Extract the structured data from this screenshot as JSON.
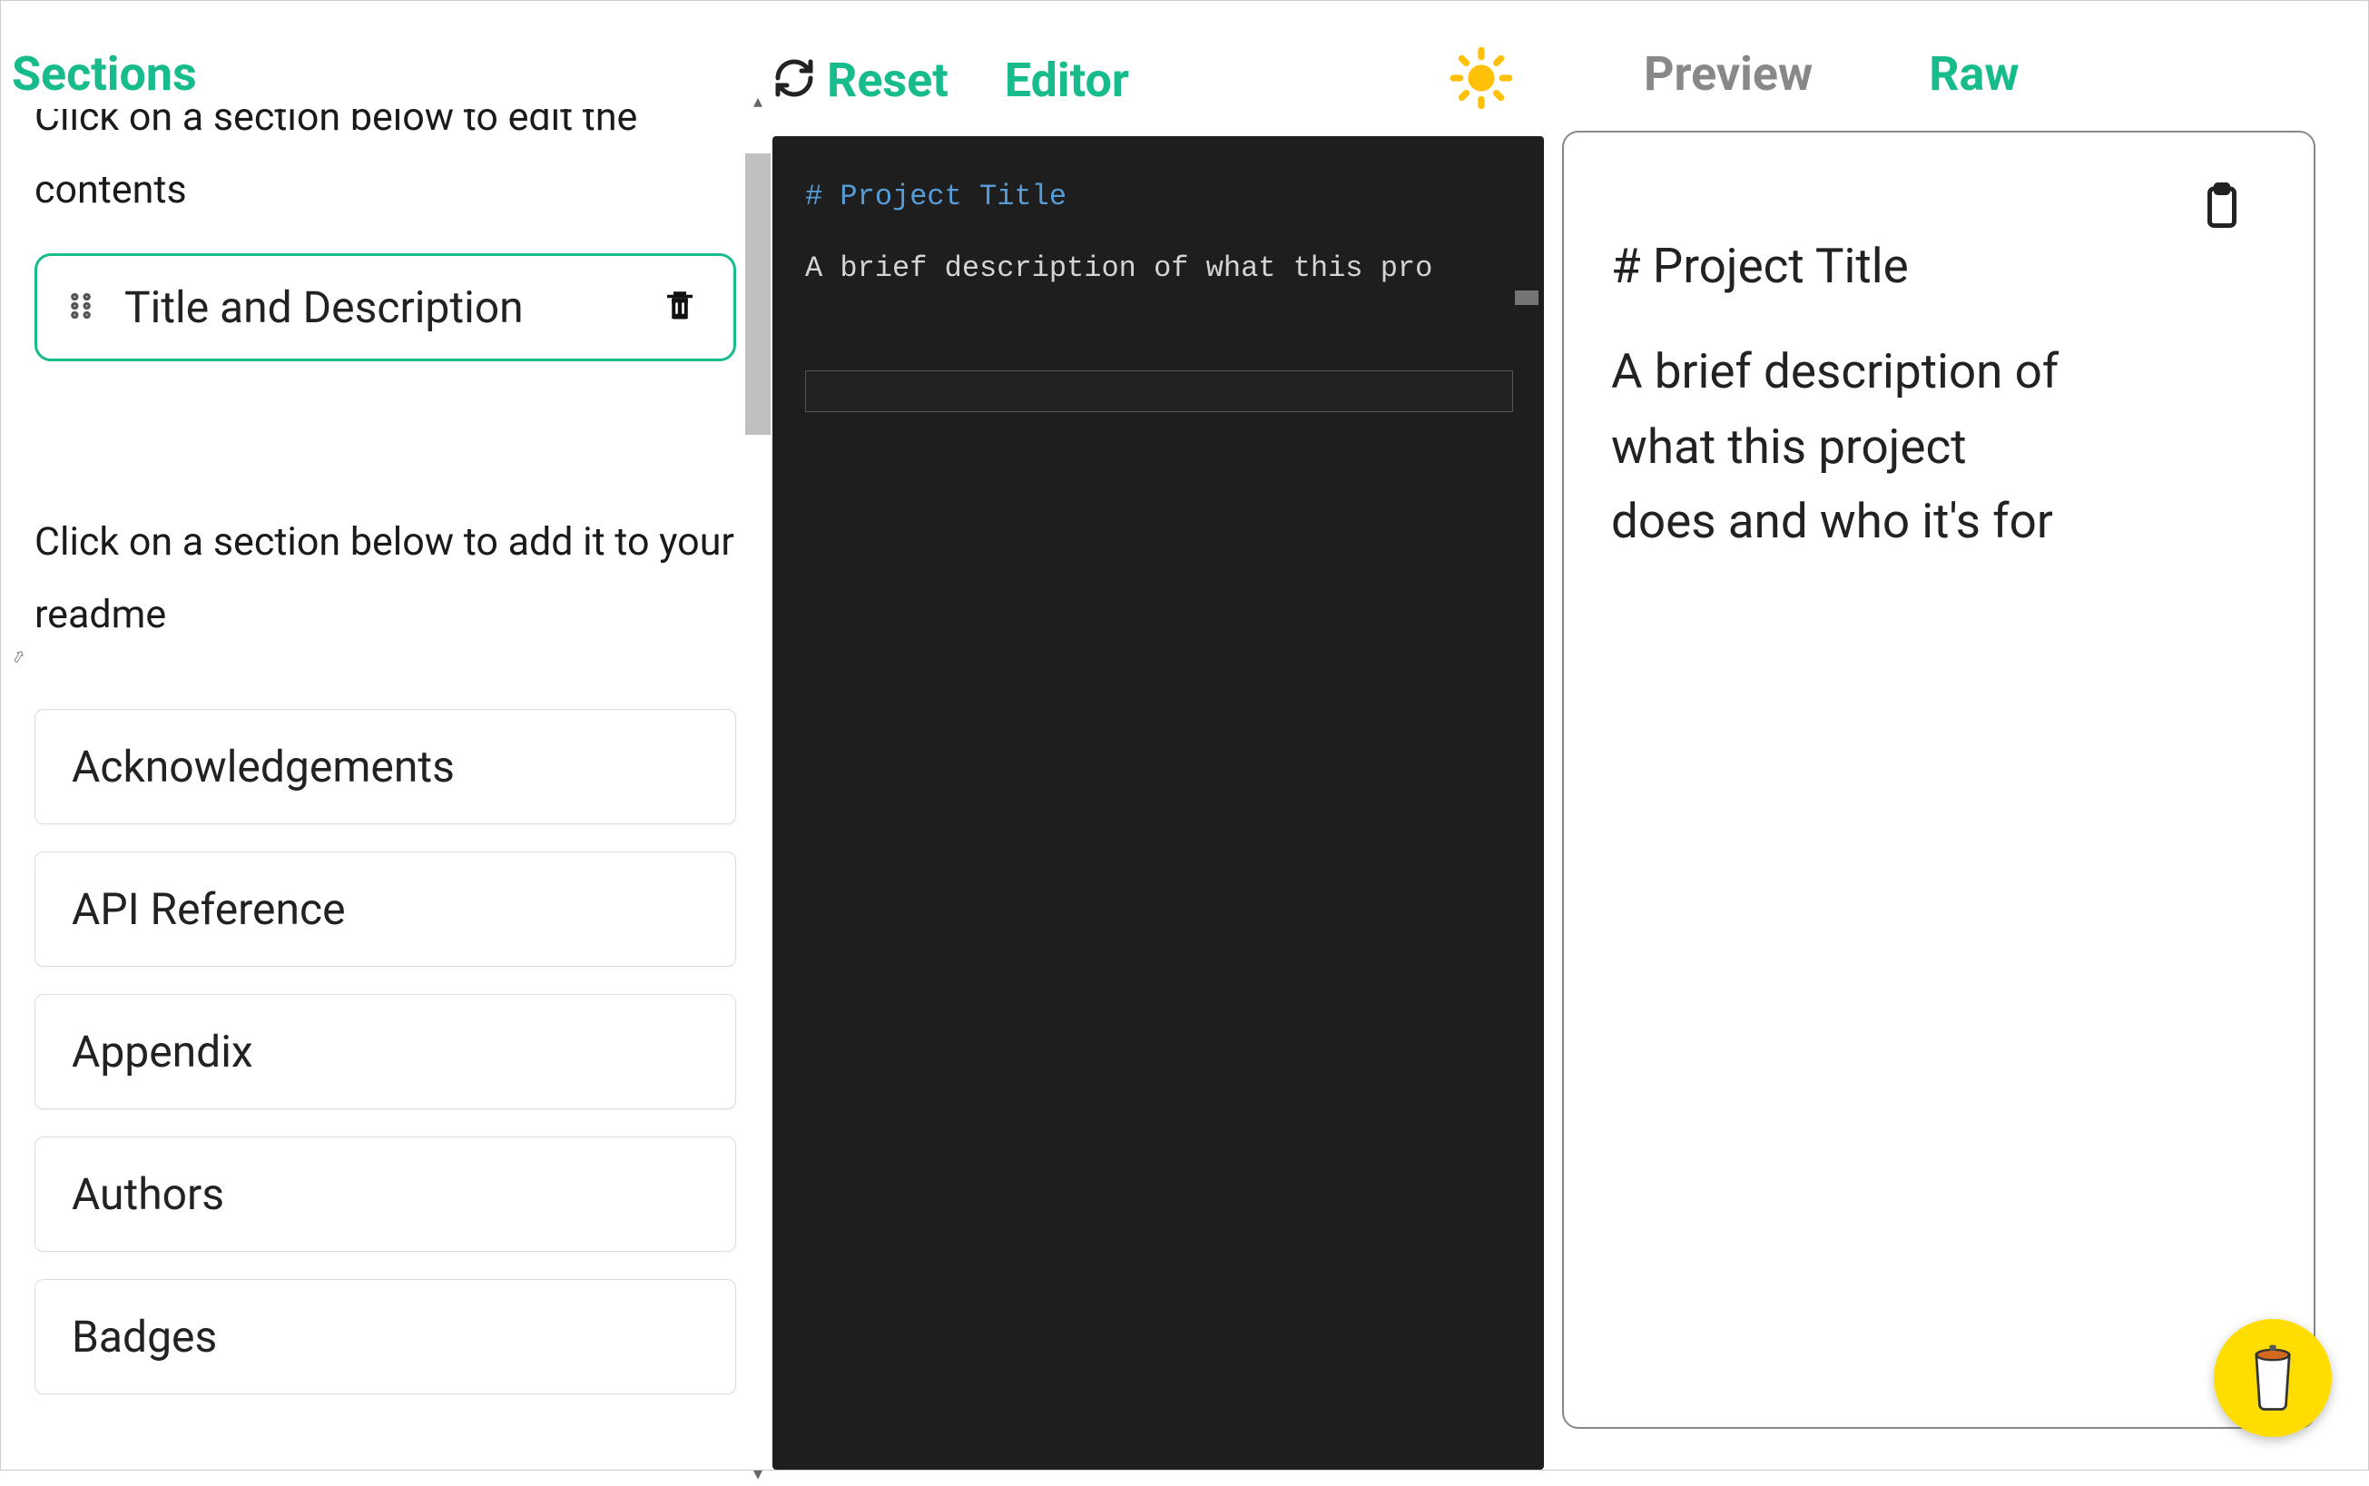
{
  "sections_panel": {
    "title": "Sections",
    "edit_instruction": "Click on a section below to edit the contents",
    "selected_section_label": "Title and Description",
    "add_instruction": "Click on a section below to add it to your readme",
    "available_sections": [
      "Acknowledgements",
      "API Reference",
      "Appendix",
      "Authors",
      "Badges"
    ]
  },
  "editor_panel": {
    "reset_label": "Reset",
    "editor_label": "Editor",
    "code_heading": "# Project Title",
    "code_body": "A brief description of what this pro"
  },
  "preview_panel": {
    "preview_tab": "Preview",
    "raw_tab": "Raw",
    "raw_title": "# Project Title",
    "raw_description": "A brief description of what this project does and who it's for"
  }
}
